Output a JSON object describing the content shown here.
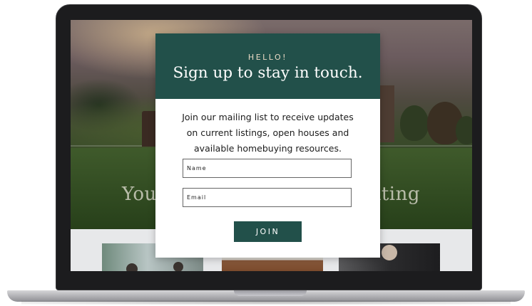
{
  "hero": {
    "headline_left": "You",
    "headline_right": "iting"
  },
  "modal": {
    "eyebrow": "HELLO!",
    "title": "Sign up to stay in touch.",
    "body": "Join our mailing list to receive updates on current listings, open houses and available homebuying resources.",
    "name_placeholder": "Name",
    "email_placeholder": "Email",
    "join_label": "JOIN"
  },
  "colors": {
    "brand_green": "#22504a",
    "eyebrow_tint": "#e8d9c4"
  }
}
